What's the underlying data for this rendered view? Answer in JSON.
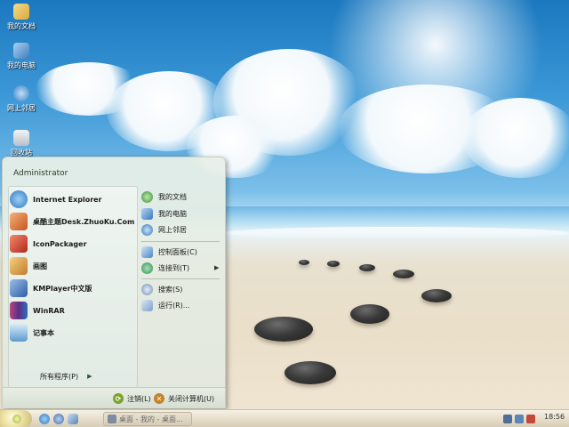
{
  "desktop": {
    "icons": [
      {
        "label": "我的文档",
        "icon": "my-documents-icon",
        "color": "#e8c66b"
      },
      {
        "label": "我的电脑",
        "icon": "my-computer-icon",
        "color": "#6aa6d9"
      },
      {
        "label": "网上邻居",
        "icon": "network-places-icon",
        "color": "#4f8fd0"
      },
      {
        "label": "回收站",
        "icon": "recycle-bin-icon",
        "color": "#d9dde3"
      }
    ]
  },
  "start_menu": {
    "user_name": "Administrator",
    "pinned_programs": [
      {
        "label": "Internet Explorer",
        "icon": "internet-explorer-icon",
        "color": "#3a86d4"
      },
      {
        "label": "桌酷主题Desk.ZhuoKu.Com",
        "icon": "zhuoku-theme-icon",
        "color": "#d9722e"
      },
      {
        "label": "IconPackager",
        "icon": "iconpackager-icon",
        "color": "#c23a2b"
      },
      {
        "label": "画图",
        "icon": "paint-icon",
        "color": "#c98f3c"
      },
      {
        "label": "KMPlayer中文版",
        "icon": "kmplayer-icon",
        "color": "#3f6fb5"
      },
      {
        "label": "WinRAR",
        "icon": "winrar-icon",
        "color": "#8a3b6e"
      },
      {
        "label": "记事本",
        "icon": "notepad-icon",
        "color": "#6fa6d2"
      }
    ],
    "all_programs_label": "所有程序(P)",
    "all_programs_arrow": "▶",
    "places": [
      {
        "label": "我的文档",
        "icon": "my-documents-icon",
        "color": "#5aa35a"
      },
      {
        "label": "我的电脑",
        "icon": "my-computer-icon",
        "color": "#5b95cf"
      },
      {
        "label": "网上邻居",
        "icon": "network-places-icon",
        "color": "#4a86c7"
      }
    ],
    "system": [
      {
        "label": "控制面板(C)",
        "icon": "control-panel-icon",
        "color": "#4f8fd0"
      },
      {
        "label": "连接到(T)",
        "icon": "connect-to-icon",
        "color": "#3aa05a",
        "submenu_arrow": "▶"
      }
    ],
    "tools": [
      {
        "label": "搜索(S)",
        "icon": "search-icon",
        "color": "#6f8fb8"
      },
      {
        "label": "运行(R)...",
        "icon": "run-icon",
        "color": "#7aa0c8"
      }
    ],
    "footer": {
      "logoff_label": "注销(L)",
      "logoff_glyph": "⟳",
      "shutdown_label": "关闭计算机(U)",
      "shutdown_glyph": "✕",
      "logoff_color": "#7aa32c",
      "shutdown_color": "#c4832a"
    }
  },
  "taskbar": {
    "quick_launch": [
      {
        "icon": "internet-explorer-icon",
        "color": "#3a86d4"
      },
      {
        "icon": "media-player-icon",
        "color": "#4f7fc0"
      },
      {
        "icon": "show-desktop-icon",
        "color": "#6a8fb8"
      }
    ],
    "task_button_label": "桌面 - 我的 - 桌面...",
    "tray_icons": [
      {
        "icon": "network-tray-icon",
        "color": "#4f6f9a"
      },
      {
        "icon": "volume-tray-icon",
        "color": "#5a86b8"
      },
      {
        "icon": "security-tray-icon",
        "color": "#c24a3a"
      }
    ],
    "clock": "18:56"
  }
}
